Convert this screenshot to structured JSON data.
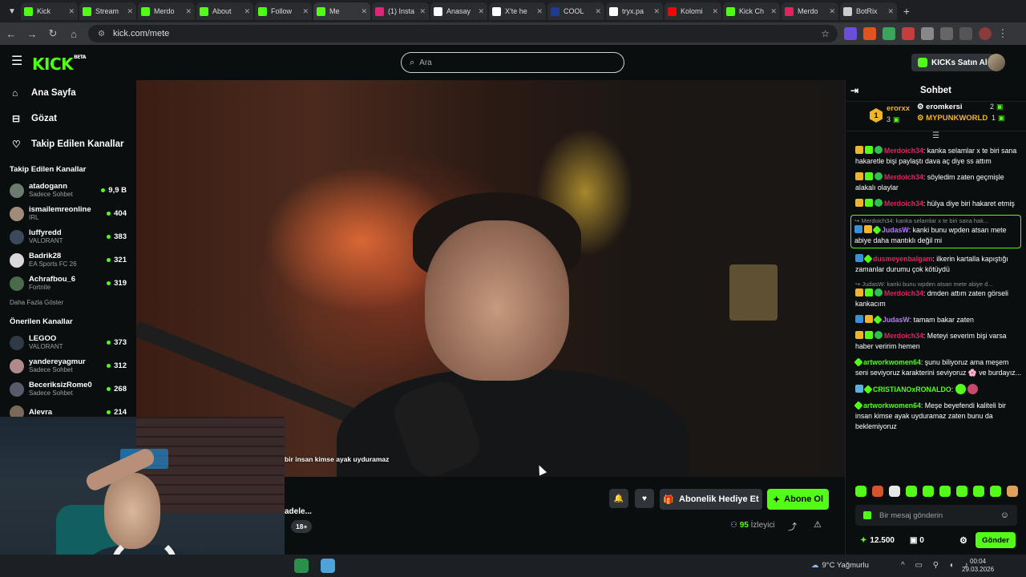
{
  "browser": {
    "tabs": [
      {
        "label": "Kick",
        "fav": "#53fc18"
      },
      {
        "label": "Stream",
        "fav": "#53fc18"
      },
      {
        "label": "Merdo",
        "fav": "#53fc18"
      },
      {
        "label": "About",
        "fav": "#53fc18"
      },
      {
        "label": "Follow",
        "fav": "#53fc18"
      },
      {
        "label": "Me",
        "fav": "#53fc18"
      },
      {
        "label": "(1) Insta",
        "fav": "#d62976"
      },
      {
        "label": "Anasay",
        "fav": "#ffffff"
      },
      {
        "label": "X'te he",
        "fav": "#ffffff"
      },
      {
        "label": "COOL",
        "fav": "#1d3b8f"
      },
      {
        "label": "tryx.pa",
        "fav": "#ffffff"
      },
      {
        "label": "Kolomi",
        "fav": "#ff0000"
      },
      {
        "label": "Kick Ch",
        "fav": "#53fc18"
      },
      {
        "label": "Merdo",
        "fav": "#e0245e"
      },
      {
        "label": "BotRix",
        "fav": "#cccccc"
      }
    ],
    "url": "kick.com/mete"
  },
  "header": {
    "logo": "KICK",
    "logo_tag": "BETA",
    "search_placeholder": "Ara",
    "buy_kicks": "KICKs Satın Al"
  },
  "sidebar": {
    "nav": [
      {
        "label": "Ana Sayfa",
        "icon": "home-icon"
      },
      {
        "label": "Gözat",
        "icon": "browse-icon"
      },
      {
        "label": "Takip Edilen Kanallar",
        "icon": "heart-icon"
      }
    ],
    "followed_title": "Takip Edilen Kanallar",
    "followed": [
      {
        "name": "atadogann",
        "category": "Sadece Sohbet",
        "viewers": "9,9 B"
      },
      {
        "name": "ismailemreonline",
        "category": "IRL",
        "viewers": "404"
      },
      {
        "name": "luffyredd",
        "category": "VALORANT",
        "viewers": "383"
      },
      {
        "name": "Badrik28",
        "category": "EA Sports FC 26",
        "viewers": "321"
      },
      {
        "name": "Achrafbou_6",
        "category": "Fortnite",
        "viewers": "319"
      }
    ],
    "show_more": "Daha Fazla Göster",
    "recommended_title": "Önerilen Kanallar",
    "recommended": [
      {
        "name": "LEGOO",
        "category": "VALORANT",
        "viewers": "373"
      },
      {
        "name": "yandereyagmur",
        "category": "Sadece Sohbet",
        "viewers": "312"
      },
      {
        "name": "BeceriksizRome0",
        "category": "Sadece Sohbet",
        "viewers": "268"
      },
      {
        "name": "Alevra",
        "category": "",
        "viewers": "214"
      }
    ]
  },
  "video": {
    "caption": "bir insan kimse ayak uyduramaz"
  },
  "stream_info": {
    "title_fragment": "adele...",
    "age_badge": "18+",
    "gift_button": "Abonelik Hediye Et",
    "subscribe_button": "Abone Ol",
    "viewer_count": "95",
    "viewer_label": "İzleyici"
  },
  "chat": {
    "title": "Sohbet",
    "leaderboard": {
      "rank": "1",
      "first_user": "erorxx",
      "first_count": "3",
      "second_user": "eromkersi",
      "second_count": "2",
      "third_user": "MYPUNKWORLD",
      "third_count": "1"
    },
    "messages": [
      {
        "user": "Merdoich34",
        "color": "#e0245e",
        "text": ": kanka selamlar x te biri sana hakaretle bişi paylaştı dava aç diye ss attım",
        "reply": ""
      },
      {
        "user": "Merdoich34",
        "color": "#e0245e",
        "text": ": söyledim zaten geçmişle alakalı olaylar",
        "reply": ""
      },
      {
        "user": "Merdoich34",
        "color": "#e0245e",
        "text": ": hülya diye biri hakaret etmiş",
        "reply": ""
      },
      {
        "user": "JudasW",
        "color": "#b57bff",
        "text": ": kanki bunu wpden atsan mete abiye daha mantıklı değil mi",
        "reply": "Merdoich34: kanka selamlar x te biri sana hak..."
      },
      {
        "user": "dusmeyenbalgam",
        "color": "#e0245e",
        "text": ": ilkerin kartalla kapıştığı zamanlar durumu çok kötüydü",
        "reply": ""
      },
      {
        "user": "Merdoich34",
        "color": "#e0245e",
        "text": ": dmden attım zaten görseli kankacım",
        "reply": "JudasW: kanki bunu wpden atsan mete abiye d..."
      },
      {
        "user": "JudasW",
        "color": "#b57bff",
        "text": ": tamam bakar zaten",
        "reply": ""
      },
      {
        "user": "Merdoich34",
        "color": "#e0245e",
        "text": ": Meteyi severim bişi varsa haber veririm hemen",
        "reply": ""
      },
      {
        "user": "artworkwomen64",
        "color": "#53fc18",
        "text": ": şunu biliyoruz ama meşem seni seviyoruz karakterini seviyoruz 🌸 ve burdayız...",
        "reply": ""
      },
      {
        "user": "CRISTIANOxRONALDO",
        "color": "#53fc18",
        "text": ":",
        "reply": ""
      },
      {
        "user": "artworkwomen64",
        "color": "#53fc18",
        "text": ": Meşe beyefendi kaliteli bir insan kimse ayak uyduramaz zaten bunu da beklemiyoruz",
        "reply": ""
      }
    ],
    "input_placeholder": "Bir mesaj gönderin",
    "kicks_balance": "12.500",
    "gift_balance": "0",
    "send_button": "Gönder"
  },
  "taskbar": {
    "weather": "9°C Yağmurlu",
    "time": "00:04",
    "date": "29.03.2026"
  },
  "colors": {
    "accent": "#53fc18",
    "background": "#0b0e0f",
    "panel": "#2f3438"
  }
}
